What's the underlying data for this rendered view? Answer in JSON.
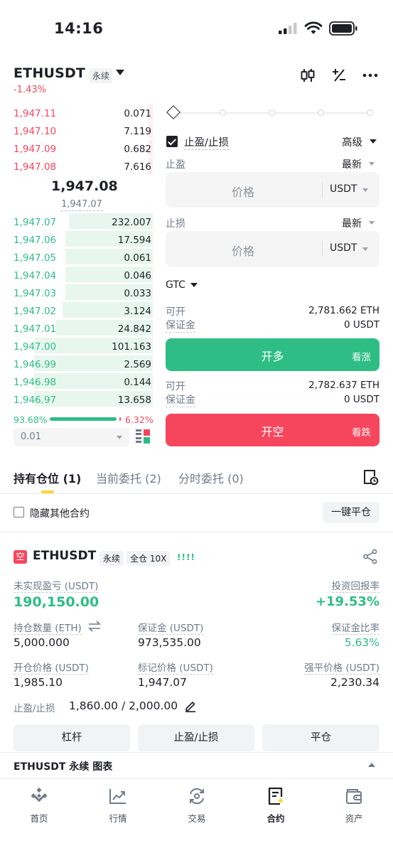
{
  "status_bar": {
    "time": "14:16"
  },
  "header": {
    "pair": "ETHUSDT",
    "contract_tag": "永续",
    "change": "-1.43%"
  },
  "order_book": {
    "asks": [
      {
        "price": "1,947.11",
        "qty": "0.071",
        "depth": 0.03
      },
      {
        "price": "1,947.10",
        "qty": "7.119",
        "depth": 0.03
      },
      {
        "price": "1,947.09",
        "qty": "0.682",
        "depth": 0.03
      },
      {
        "price": "1,947.08",
        "qty": "7.616",
        "depth": 0.03
      }
    ],
    "last_price": "1,947.08",
    "mark_price": "1,947.07",
    "bids": [
      {
        "price": "1,947.07",
        "qty": "232.007",
        "depth": 0.6
      },
      {
        "price": "1,947.06",
        "qty": "17.594",
        "depth": 0.63
      },
      {
        "price": "1,947.05",
        "qty": "0.061",
        "depth": 0.63
      },
      {
        "price": "1,947.04",
        "qty": "0.046",
        "depth": 0.63
      },
      {
        "price": "1,947.03",
        "qty": "0.033",
        "depth": 0.63
      },
      {
        "price": "1,947.02",
        "qty": "3.124",
        "depth": 0.65
      },
      {
        "price": "1,947.01",
        "qty": "24.842",
        "depth": 0.7
      },
      {
        "price": "1,947.00",
        "qty": "101.163",
        "depth": 0.85
      },
      {
        "price": "1,946.99",
        "qty": "2.569",
        "depth": 0.85
      },
      {
        "price": "1,946.98",
        "qty": "0.144",
        "depth": 0.85
      },
      {
        "price": "1,946.97",
        "qty": "13.658",
        "depth": 0.85
      }
    ],
    "bid_ratio": "93.68%",
    "ask_ratio": "6.32%",
    "bid_ratio_value": 0.9368,
    "step": "0.01"
  },
  "order_form": {
    "tpsl_label": "止盈/止损",
    "advanced": "高级",
    "tp_label": "止盈",
    "sl_label": "止损",
    "trigger_type": "最新",
    "price_placeholder": "价格",
    "unit": "USDT",
    "tif": "GTC",
    "long": {
      "avail_label": "可开",
      "avail_value": "2,781.662 ETH",
      "margin_label": "保证金",
      "margin_value": "0 USDT",
      "button": "开多",
      "sub": "看涨"
    },
    "short": {
      "avail_label": "可开",
      "avail_value": "2,782.637 ETH",
      "margin_label": "保证金",
      "margin_value": "0 USDT",
      "button": "开空",
      "sub": "看跌"
    }
  },
  "tabs": {
    "positions": "持有仓位 (1)",
    "open_orders": "当前委托 (2)",
    "twap": "分时委托 (0)"
  },
  "filter": {
    "hide_other": "隐藏其他合约",
    "close_all": "一键平仓"
  },
  "position": {
    "side_badge": "空",
    "symbol": "ETHUSDT",
    "contract_tag": "永续",
    "margin_tag": "全仓 10X",
    "risk_bars": "!!!!",
    "unrealized_label": "未实现盈亏 (USDT)",
    "unrealized_value": "190,150.00",
    "roe_label": "投资回报率",
    "roe_value": "+19.53%",
    "size_label": "持仓数量 (ETH)",
    "size_value": "5,000.000",
    "margin_label": "保证金 (USDT)",
    "margin_value": "973,535.00",
    "margin_ratio_label": "保证金比率",
    "margin_ratio_value": "5.63%",
    "entry_label": "开仓价格 (USDT)",
    "entry_value": "1,985.10",
    "mark_label": "标记价格 (USDT)",
    "mark_value": "1,947.07",
    "liq_label": "强平价格 (USDT)",
    "liq_value": "2,230.34",
    "tpsl_label": "止盈/止损",
    "tpsl_value": "1,860.00 / 2,000.00",
    "btn_leverage": "杠杆",
    "btn_tpsl": "止盈/止损",
    "btn_close": "平仓"
  },
  "chart_strip": "ETHUSDT 永续 图表",
  "nav": [
    {
      "label": "首页",
      "icon": "home-icon"
    },
    {
      "label": "行情",
      "icon": "markets-icon"
    },
    {
      "label": "交易",
      "icon": "trade-icon"
    },
    {
      "label": "合约",
      "icon": "futures-icon"
    },
    {
      "label": "资产",
      "icon": "wallet-icon"
    }
  ],
  "colors": {
    "buy": "#2ebd85",
    "sell": "#f6465d",
    "accent": "#fcd535"
  }
}
